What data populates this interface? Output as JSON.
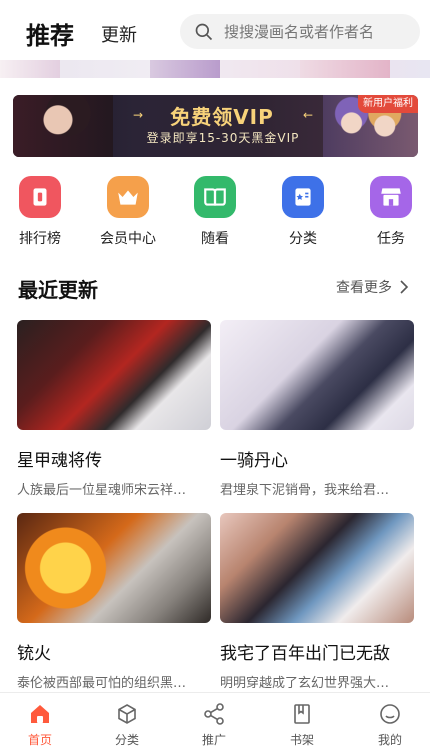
{
  "header": {
    "tab_active": "推荐",
    "tab_update": "更新",
    "search_placeholder": "搜搜漫画名或者作者名"
  },
  "banner": {
    "title": "免费领VIP",
    "subtitle": "登录即享15-30天黑金VIP",
    "corner_badge": "新用户福利"
  },
  "quick_nav": [
    {
      "label": "排行榜",
      "icon": "ranking-icon",
      "color": "#f0565f"
    },
    {
      "label": "会员中心",
      "icon": "crown-icon",
      "color": "#f5a04b"
    },
    {
      "label": "随看",
      "icon": "book-icon",
      "color": "#33b96b"
    },
    {
      "label": "分类",
      "icon": "category-icon",
      "color": "#3e71e8"
    },
    {
      "label": "任务",
      "icon": "store-icon",
      "color": "#a566e8"
    }
  ],
  "section": {
    "title": "最近更新",
    "more": "查看更多"
  },
  "cards": [
    {
      "title": "星甲魂将传",
      "desc": "人族最后一位星魂师宋云祥…"
    },
    {
      "title": "一骑丹心",
      "desc": "君埋泉下泥销骨，我来给君…"
    },
    {
      "title": "铳火",
      "desc": "泰伦被西部最可怕的组织黑…"
    },
    {
      "title": "我宅了百年出门已无敌",
      "desc": "明明穿越成了玄幻世界强大…"
    }
  ],
  "bottom_nav": [
    {
      "label": "首页",
      "icon": "home-icon",
      "active": true
    },
    {
      "label": "分类",
      "icon": "cube-icon",
      "active": false
    },
    {
      "label": "推广",
      "icon": "share-icon",
      "active": false
    },
    {
      "label": "书架",
      "icon": "bookshelf-icon",
      "active": false
    },
    {
      "label": "我的",
      "icon": "profile-icon",
      "active": false
    }
  ],
  "colors": {
    "accent": "#ff5a3c",
    "banner_gold": "#f7d27a"
  }
}
